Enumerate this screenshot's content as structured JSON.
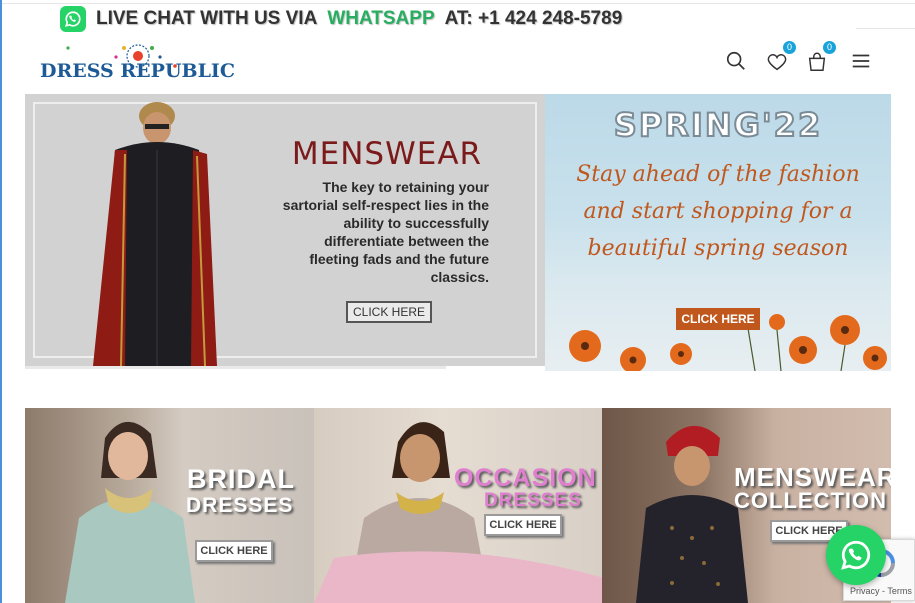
{
  "promo": {
    "prefix": "LIVE CHAT WITH US VIA",
    "highlight": "WHATSAPP",
    "suffix": "AT:  +1 424 248-5789"
  },
  "header": {
    "logo_text": "DRESS REPUBLIC",
    "wishlist_count": "0",
    "cart_count": "0",
    "icons": [
      "search-icon",
      "heart-icon",
      "shopping-bag-icon",
      "menu-icon"
    ]
  },
  "banners": {
    "menswear": {
      "title": "MENSWEAR",
      "body": "The key to retaining your sartorial self-respect lies in the ability to successfully differentiate between the fleeting fads and the future classics.",
      "cta": "CLICK HERE"
    },
    "spring": {
      "title": "SPRING'22",
      "body": "Stay ahead of the fashion and start shopping for a beautiful spring season",
      "cta": "CLICK HERE"
    }
  },
  "tiles": [
    {
      "line1": "BRIDAL",
      "line2": "DRESSES",
      "cta": "CLICK HERE"
    },
    {
      "line1": "OCCASION",
      "line2": "DRESSES",
      "cta": "CLICK HERE"
    },
    {
      "line1": "MENSWEAR",
      "line2": "COLLECTION",
      "cta": "CLICK HERE"
    }
  ],
  "recaptcha": {
    "terms": "Privacy - Terms"
  },
  "colors": {
    "whatsapp_green": "#25d366",
    "accent_blue": "#1aa3d9",
    "menswear_title": "#7a1a1a",
    "spring_orange": "#c0581e",
    "occasion_pink": "#e07fd0"
  }
}
